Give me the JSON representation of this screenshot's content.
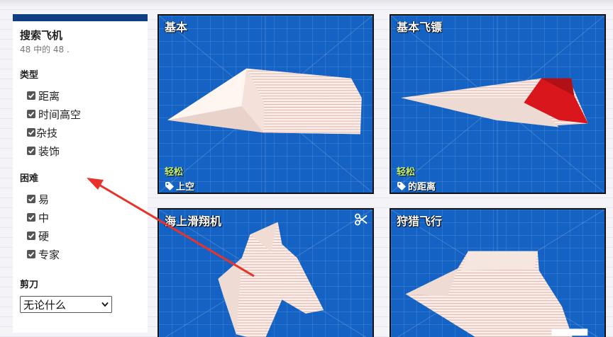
{
  "sidebar": {
    "title": "搜索飞机",
    "count": "48 中的 48 .",
    "sections": {
      "type": {
        "heading": "类型",
        "options": [
          "距离",
          "时间高空",
          "杂技",
          "装饰"
        ]
      },
      "difficulty": {
        "heading": "困难",
        "options": [
          "易",
          "中",
          "硬",
          "专家"
        ]
      },
      "scissors": {
        "heading": "剪刀",
        "selected": "无论什么"
      }
    }
  },
  "cards": [
    {
      "title": "基本",
      "difficulty": "轻松",
      "tag": "上空"
    },
    {
      "title": "基本飞镖",
      "difficulty": "轻松",
      "tag": "的距离"
    },
    {
      "title": "海上滑翔机"
    },
    {
      "title": "狩猎飞行"
    }
  ],
  "colors": {
    "sidebar_accent": "#0f3f82",
    "card_background": "#1463c4",
    "difficulty_text": "#c9f06a",
    "annotation_arrow": "#e8322a"
  }
}
